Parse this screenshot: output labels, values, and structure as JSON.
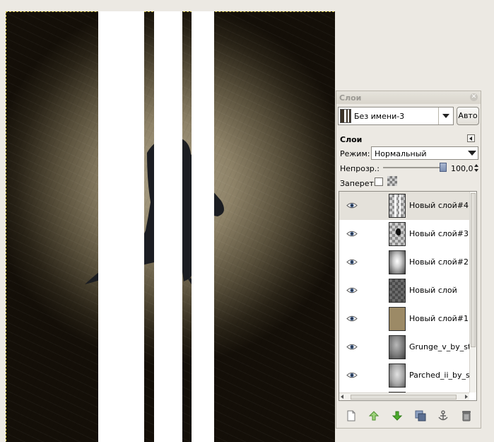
{
  "dock": {
    "title": "Слои",
    "image_name": "Без имени-3",
    "auto_label": "Авто",
    "panel_header": "Слои",
    "mode_label": "Режим:",
    "mode_value": "Нормальный",
    "opacity_label": "Непрозр.:",
    "opacity_value": "100,0",
    "opacity_fraction": 1.0,
    "lock_label": "Запереть:"
  },
  "layers": [
    {
      "name": "Новый слой#4",
      "thumb": "stripes",
      "selected": true
    },
    {
      "name": "Новый слой#3",
      "thumb": "crow"
    },
    {
      "name": "Новый слой#2",
      "thumb": "glow"
    },
    {
      "name": "Новый слой",
      "thumb": "dark"
    },
    {
      "name": "Новый слой#1",
      "thumb": "tan"
    },
    {
      "name": "Grunge_v_by_struc",
      "thumb": "grunge"
    },
    {
      "name": "Parched_ii_by_struc",
      "thumb": "parched"
    },
    {
      "name": "",
      "thumb": "white"
    }
  ],
  "toolbar_icons": [
    "new-layer-icon",
    "raise-layer-icon",
    "lower-layer-icon",
    "duplicate-layer-icon",
    "anchor-layer-icon",
    "delete-layer-icon"
  ],
  "colors": {
    "accent_green": "#4cab2c",
    "selected_row": "#e4e1da",
    "selection_border": "#d8c94a"
  }
}
